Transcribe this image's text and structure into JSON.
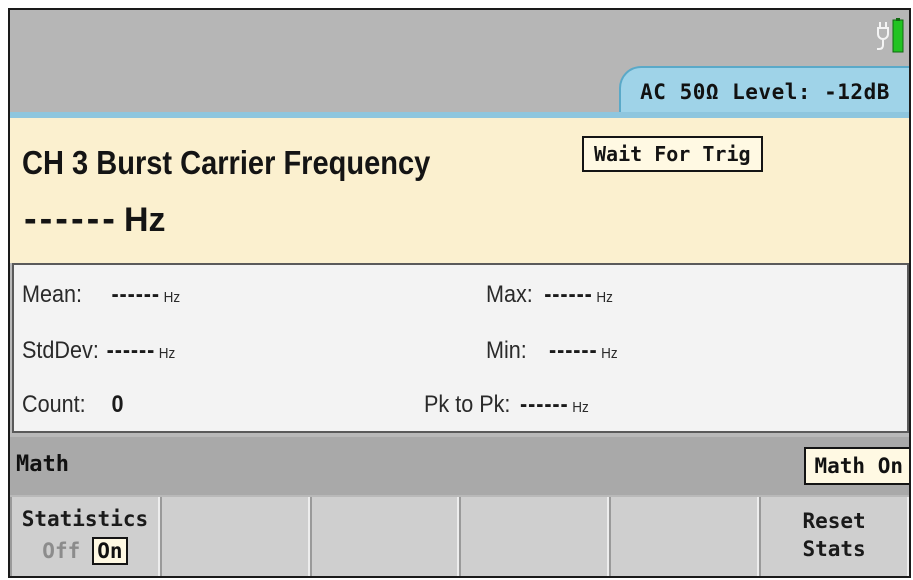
{
  "status": {
    "input_config": "AC 50Ω Level: -12dB",
    "power_icon": "plug-battery-icon",
    "tab_color": "#9fd3e8"
  },
  "measurement": {
    "title": "CH 3 Burst Carrier Frequency",
    "trigger_status": "Wait For Trig",
    "value": "------",
    "unit": "Hz",
    "background_color": "#fbf0cf"
  },
  "statistics": {
    "mean": {
      "label": "Mean:",
      "value": "------",
      "unit": "Hz"
    },
    "stddev": {
      "label": "StdDev:",
      "value": "------",
      "unit": "Hz"
    },
    "count": {
      "label": "Count:",
      "value": "0"
    },
    "max": {
      "label": "Max:",
      "value": "------",
      "unit": "Hz"
    },
    "min": {
      "label": "Min:",
      "value": "------",
      "unit": "Hz"
    },
    "pk_to_pk": {
      "label": "Pk to Pk:",
      "value": "------",
      "unit": "Hz"
    }
  },
  "math_bar": {
    "label": "Math",
    "state": "Math On"
  },
  "softkeys": {
    "statistics": {
      "label": "Statistics",
      "off": "Off",
      "on": "On",
      "selected": "On"
    },
    "reset": {
      "line1": "Reset",
      "line2": "Stats"
    }
  }
}
